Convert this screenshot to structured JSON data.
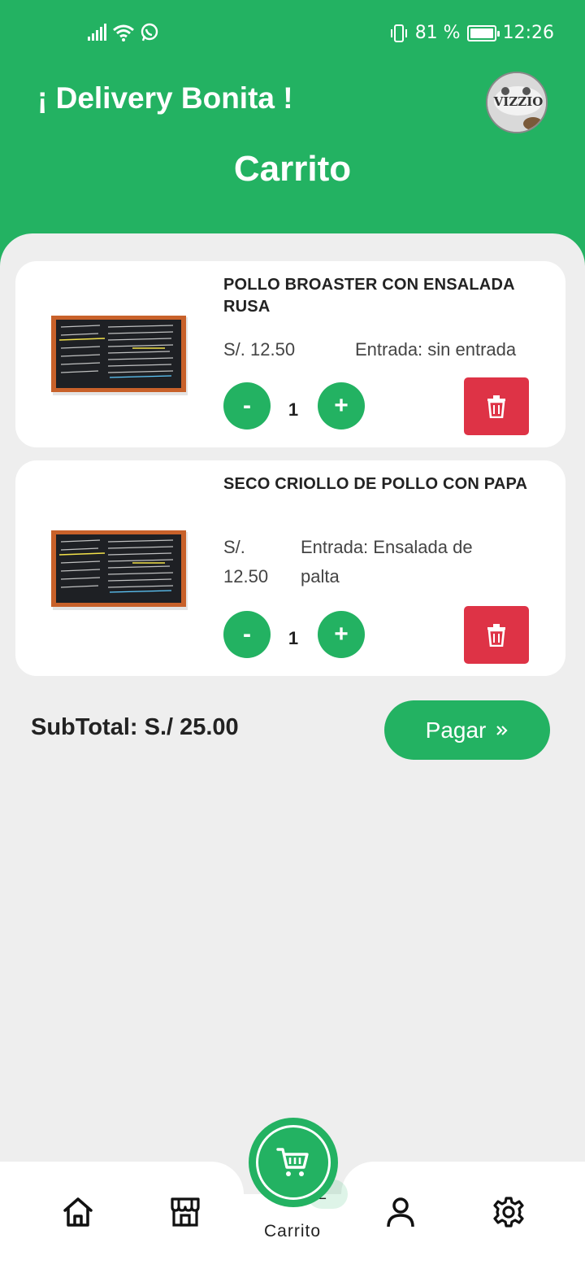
{
  "status": {
    "battery": "81 %",
    "time": "12:26"
  },
  "header": {
    "app_title": "¡ Delivery Bonita !",
    "page_title": "Carrito"
  },
  "cart": {
    "items": [
      {
        "title": "POLLO BROASTER CON ENSALADA RUSA",
        "price": "S/. 12.50",
        "entrada": "Entrada: sin entrada",
        "quantity": "1",
        "minus": "-",
        "plus": "+"
      },
      {
        "title": "SECO CRIOLLO DE POLLO CON PAPA",
        "price": "S/. 12.50",
        "entrada": "Entrada: Ensalada de palta",
        "quantity": "1",
        "minus": "-",
        "plus": "+"
      }
    ],
    "subtotal": "SubTotal: S./ 25.00",
    "pay_label": "Pagar"
  },
  "nav": {
    "cart_label": "Carrito",
    "cart_badge": "2"
  },
  "colors": {
    "primary": "#23b262",
    "danger": "#de3346",
    "background": "#eeeeee"
  }
}
